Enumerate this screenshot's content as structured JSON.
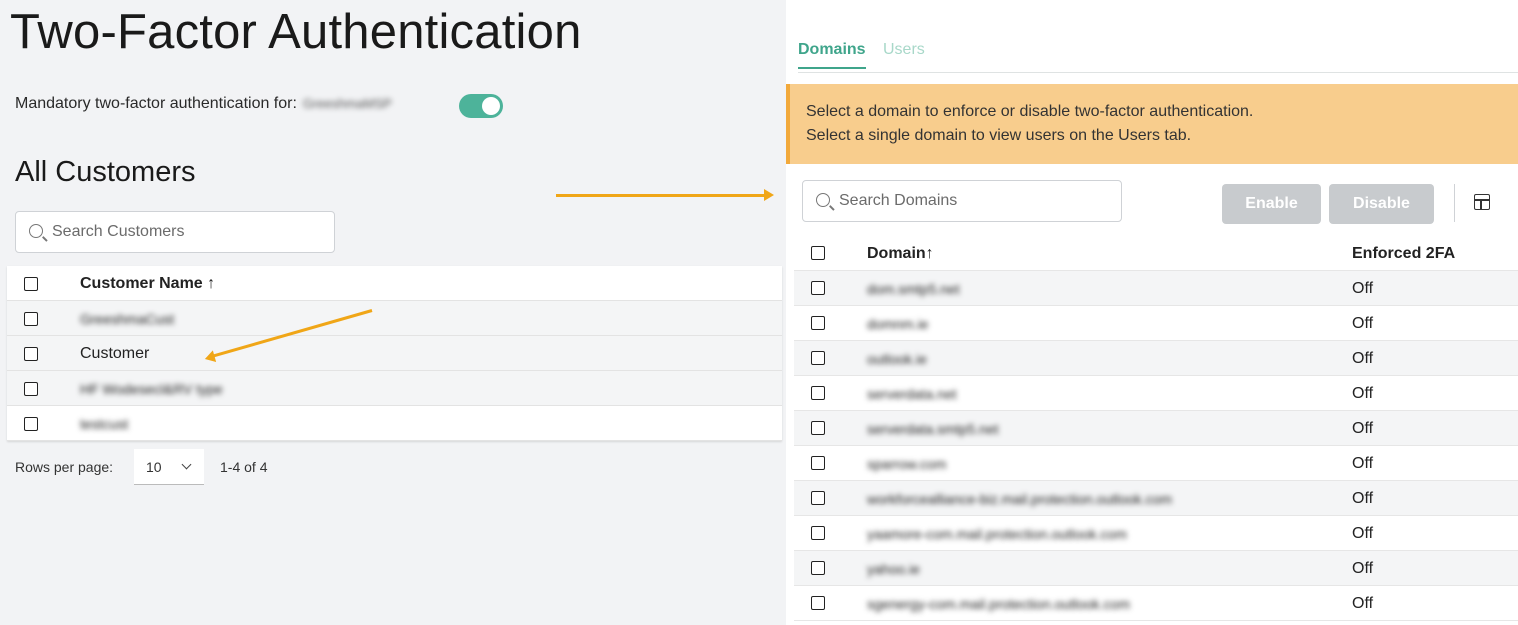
{
  "page": {
    "title": "Two-Factor Authentication",
    "mandatory_label": "Mandatory two-factor authentication for:",
    "mandatory_target": "GreeshmaMSP",
    "mandatory_enabled": true
  },
  "customers": {
    "title": "All Customers",
    "search_placeholder": "Search Customers",
    "column_header": "Customer Name",
    "sort_icon": "arrow-up-icon",
    "rows": [
      "GreeshmaCust",
      "Customer",
      "HF Wodesecl&RV type",
      "testcust"
    ],
    "pagination": {
      "rows_per_page_label": "Rows per page:",
      "rows_per_page": "10",
      "range": "1-4 of 4"
    }
  },
  "domains_panel": {
    "tabs": [
      {
        "label": "Domains",
        "active": true
      },
      {
        "label": "Users",
        "active": false
      }
    ],
    "banner": {
      "line1": "Select a domain to enforce or disable two-factor authentication.",
      "line2": "Select a single domain to view users on the Users tab."
    },
    "search_placeholder": "Search Domains",
    "enable_label": "Enable",
    "disable_label": "Disable",
    "columns": {
      "domain": "Domain",
      "enforced": "Enforced 2FA"
    },
    "rows": [
      {
        "domain": "dom.smtp5.net",
        "enforced": "Off"
      },
      {
        "domain": "domnm.ie",
        "enforced": "Off"
      },
      {
        "domain": "outlook.ie",
        "enforced": "Off"
      },
      {
        "domain": "serverdata.net",
        "enforced": "Off"
      },
      {
        "domain": "serverdata.smtp5.net",
        "enforced": "Off"
      },
      {
        "domain": "sparrow.com",
        "enforced": "Off"
      },
      {
        "domain": "workforcealliance-biz.mail.protection.outlook.com",
        "enforced": "Off"
      },
      {
        "domain": "yaamore-com.mail.protection.outlook.com",
        "enforced": "Off"
      },
      {
        "domain": "yahoo.ie",
        "enforced": "Off"
      },
      {
        "domain": "sgenergy-com.mail.protection.outlook.com",
        "enforced": "Off"
      }
    ]
  },
  "colors": {
    "accent": "#3fa58b",
    "toggle_on": "#4db39a",
    "banner_bg": "#f8cd8d",
    "annotation_arrow": "#f0a617",
    "disabled_button": "#c8cbce"
  }
}
